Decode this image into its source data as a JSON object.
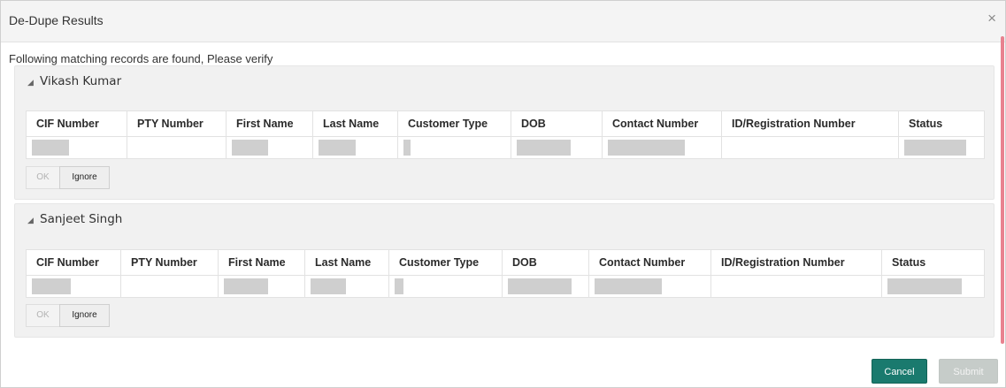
{
  "dialog": {
    "title": "De-Dupe Results",
    "close_label": "×",
    "intro": "Following matching records are found, Please verify"
  },
  "columns": [
    "CIF Number",
    "PTY Number",
    "First Name",
    "Last Name",
    "Customer Type",
    "DOB",
    "Contact Number",
    "ID/Registration Number",
    "Status"
  ],
  "groups": [
    {
      "name": "Vikash Kumar",
      "rows": [
        {
          "cif_number": "",
          "pty_number": "",
          "first_name": "",
          "last_name": "",
          "customer_type": "",
          "dob": "",
          "contact_number": "",
          "id_registration_number": "",
          "status": ""
        }
      ],
      "ok_label": "OK",
      "ignore_label": "Ignore"
    },
    {
      "name": "Sanjeet Singh",
      "rows": [
        {
          "cif_number": "",
          "pty_number": "",
          "first_name": "",
          "last_name": "",
          "customer_type": "",
          "dob": "",
          "contact_number": "",
          "id_registration_number": "",
          "status": ""
        }
      ],
      "ok_label": "OK",
      "ignore_label": "Ignore"
    }
  ],
  "footer": {
    "cancel_label": "Cancel",
    "submit_label": "Submit"
  },
  "colors": {
    "primary_button": "#1a7a6e",
    "disabled_button": "#c6ccc9",
    "scrollbar": "#e8828f",
    "redaction": "#cfcfcf"
  }
}
